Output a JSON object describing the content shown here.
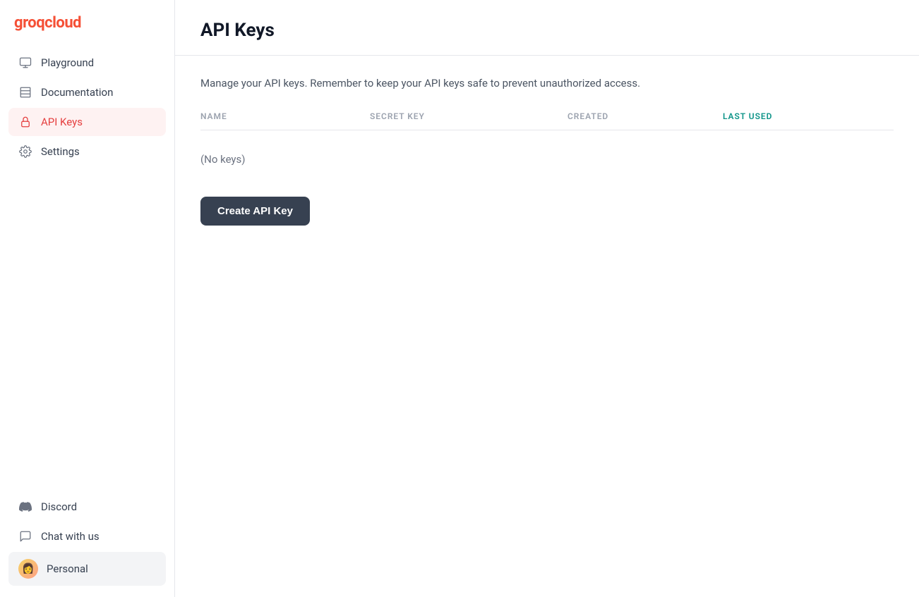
{
  "logo": {
    "prefix": "groq",
    "suffix": "cloud"
  },
  "sidebar": {
    "nav_items": [
      {
        "id": "playground",
        "label": "Playground",
        "icon": "monitor"
      },
      {
        "id": "documentation",
        "label": "Documentation",
        "icon": "book"
      },
      {
        "id": "api-keys",
        "label": "API Keys",
        "icon": "lock",
        "active": true
      },
      {
        "id": "settings",
        "label": "Settings",
        "icon": "gear"
      }
    ],
    "bottom_items": [
      {
        "id": "discord",
        "label": "Discord",
        "icon": "gamepad"
      },
      {
        "id": "chat-with-us",
        "label": "Chat with us",
        "icon": "chat"
      }
    ],
    "user": {
      "label": "Personal",
      "avatar": "👩"
    }
  },
  "main": {
    "page_title": "API Keys",
    "description": "Manage your API keys. Remember to keep your API keys safe to prevent unauthorized access.",
    "table": {
      "columns": [
        {
          "id": "name",
          "label": "NAME",
          "style": "normal"
        },
        {
          "id": "secret_key",
          "label": "SECRET KEY",
          "style": "normal"
        },
        {
          "id": "created",
          "label": "CREATED",
          "style": "normal"
        },
        {
          "id": "last_used",
          "label": "LAST USED",
          "style": "teal"
        }
      ],
      "empty_message": "(No keys)"
    },
    "create_button_label": "Create API Key"
  }
}
